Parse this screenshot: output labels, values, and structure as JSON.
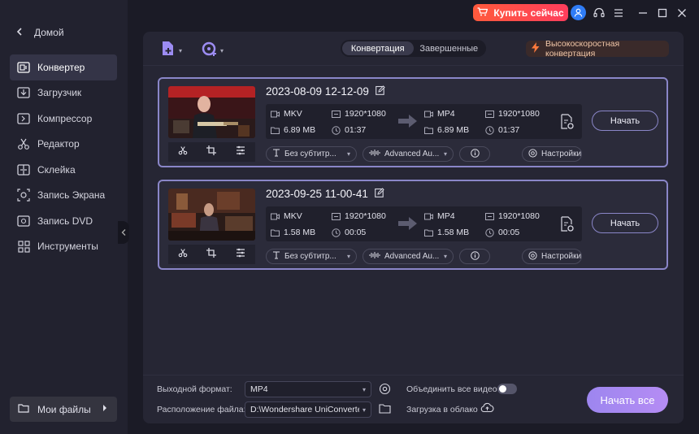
{
  "sidebar": {
    "back_label": "Домой",
    "items": [
      {
        "label": "Конвертер",
        "icon": "converter-icon",
        "active": true
      },
      {
        "label": "Загрузчик",
        "icon": "download-icon",
        "active": false
      },
      {
        "label": "Компрессор",
        "icon": "compress-icon",
        "active": false
      },
      {
        "label": "Редактор",
        "icon": "scissors-icon",
        "active": false
      },
      {
        "label": "Склейка",
        "icon": "merge-icon",
        "active": false
      },
      {
        "label": "Запись Экрана",
        "icon": "screen-record-icon",
        "active": false
      },
      {
        "label": "Запись DVD",
        "icon": "dvd-icon",
        "active": false
      },
      {
        "label": "Инструменты",
        "icon": "grid-icon",
        "active": false
      }
    ],
    "my_files_label": "Мои файлы"
  },
  "titlebar": {
    "buy_label": "Купить сейчас",
    "buy_color": "#ff4a4a"
  },
  "toolbar": {
    "tabs": [
      {
        "label": "Конвертация",
        "active": true
      },
      {
        "label": "Завершенные",
        "active": false
      }
    ],
    "high_speed_label": "Высокоскоростная конвертация"
  },
  "files": [
    {
      "name": "2023-08-09 12-12-09",
      "src_format": "MKV",
      "src_resolution": "1920*1080",
      "src_size": "6.89 MB",
      "src_duration": "01:37",
      "dst_format": "MP4",
      "dst_resolution": "1920*1080",
      "dst_size": "6.89 MB",
      "dst_duration": "01:37",
      "subtitle": "Без субтитр...",
      "audio": "Advanced Au...",
      "settings_label": "Настройки",
      "start_label": "Начать"
    },
    {
      "name": "2023-09-25 11-00-41",
      "src_format": "MKV",
      "src_resolution": "1920*1080",
      "src_size": "1.58 MB",
      "src_duration": "00:05",
      "dst_format": "MP4",
      "dst_resolution": "1920*1080",
      "dst_size": "1.58 MB",
      "dst_duration": "00:05",
      "subtitle": "Без субтитр...",
      "audio": "Advanced Au...",
      "settings_label": "Настройки",
      "start_label": "Начать"
    }
  ],
  "bottom": {
    "output_format_label": "Выходной формат:",
    "output_format_value": "MP4",
    "merge_label": "Объединить все видео",
    "merge_enabled": false,
    "location_label": "Расположение файла:",
    "location_value": "D:\\Wondershare UniConverter",
    "cloud_label": "Загрузка в облако",
    "start_all_label": "Начать все"
  },
  "accent_color": "#8a86c8"
}
